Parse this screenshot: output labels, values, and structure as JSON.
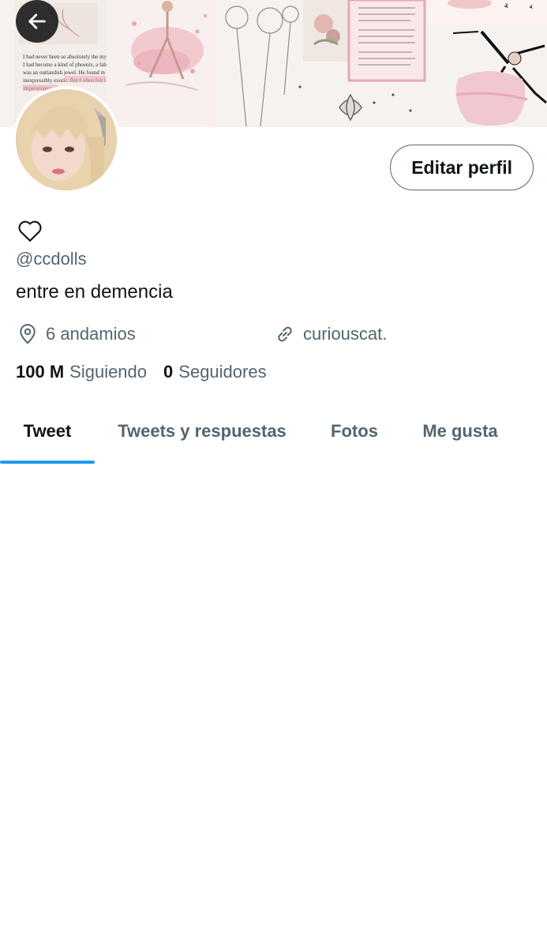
{
  "header": {
    "back_icon": "arrow-left-icon"
  },
  "banner": {
    "description_icon": "ballet-collage",
    "excerpt_lines": [
      "I had never been so absolutely the myste",
      "I had become a kind of phoenix, a fabul",
      "was an outlandish jewel. He found m",
      "inexpressibly exotic. But I often felt l",
      "impersonator"
    ]
  },
  "profile": {
    "display_name_icon": "heart-outline-icon",
    "handle": "@ccdolls",
    "bio": "entre en demencia",
    "location": "6 andamios",
    "location_icon": "location-pin-icon",
    "website": "curiouscat.",
    "website_icon": "link-icon",
    "edit_button_label": "Editar perfil"
  },
  "stats": {
    "following_count": "100 M",
    "following_label": "Siguiendo",
    "followers_count": "0",
    "followers_label": "Seguidores"
  },
  "tabs": [
    {
      "label": "Tweet",
      "active": true
    },
    {
      "label": "Tweets y respuestas",
      "active": false
    },
    {
      "label": "Fotos",
      "active": false
    },
    {
      "label": "Me gusta",
      "active": false
    }
  ],
  "colors": {
    "accent": "#1d9bf0",
    "text_primary": "#0f1419",
    "text_secondary": "#536471"
  }
}
